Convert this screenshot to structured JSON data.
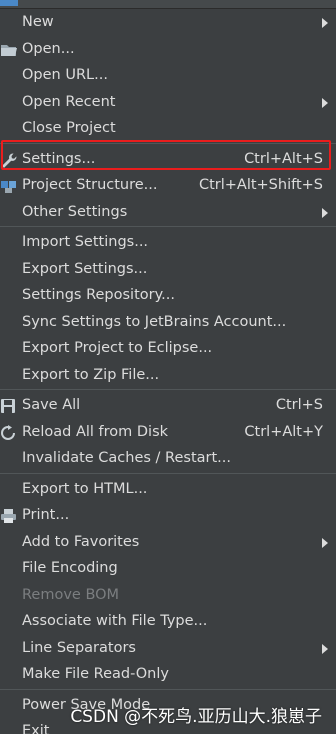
{
  "menu": {
    "items": [
      {
        "label": "New",
        "submenu": true
      },
      {
        "label": "Open...",
        "icon": "folder-icon"
      },
      {
        "label": "Open URL..."
      },
      {
        "label": "Open Recent",
        "submenu": true
      },
      {
        "label": "Close Project"
      },
      {
        "separator": true
      },
      {
        "label": "Settings...",
        "shortcut": "Ctrl+Alt+S",
        "icon": "wrench-icon"
      },
      {
        "label": "Project Structure...",
        "shortcut": "Ctrl+Alt+Shift+S",
        "icon": "project-structure-icon"
      },
      {
        "label": "Other Settings",
        "submenu": true
      },
      {
        "separator": true
      },
      {
        "label": "Import Settings..."
      },
      {
        "label": "Export Settings..."
      },
      {
        "label": "Settings Repository..."
      },
      {
        "label": "Sync Settings to JetBrains Account..."
      },
      {
        "label": "Export Project to Eclipse..."
      },
      {
        "label": "Export to Zip File..."
      },
      {
        "separator": true
      },
      {
        "label": "Save All",
        "shortcut": "Ctrl+S",
        "icon": "save-icon"
      },
      {
        "label": "Reload All from Disk",
        "shortcut": "Ctrl+Alt+Y",
        "icon": "reload-icon"
      },
      {
        "label": "Invalidate Caches / Restart..."
      },
      {
        "separator": true
      },
      {
        "label": "Export to HTML..."
      },
      {
        "label": "Print...",
        "icon": "print-icon"
      },
      {
        "label": "Add to Favorites",
        "submenu": true
      },
      {
        "label": "File Encoding"
      },
      {
        "label": "Remove BOM",
        "disabled": true
      },
      {
        "label": "Associate with File Type..."
      },
      {
        "label": "Line Separators",
        "submenu": true
      },
      {
        "label": "Make File Read-Only"
      },
      {
        "separator": true
      },
      {
        "label": "Power Save Mode"
      },
      {
        "label": "Exit"
      }
    ]
  },
  "highlight_color": "#ea1d1d",
  "watermark": "CSDN @不死鸟.亚历山大.狼崽子"
}
